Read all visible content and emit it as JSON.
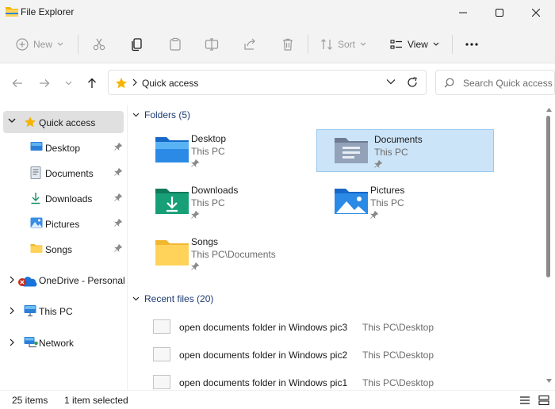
{
  "window": {
    "title": "File Explorer"
  },
  "commands": {
    "new_label": "New",
    "sort_label": "Sort",
    "view_label": "View"
  },
  "address": {
    "crumb": "Quick access"
  },
  "search": {
    "placeholder": "Search Quick access"
  },
  "nav_pane": {
    "quick_access": "Quick access",
    "pinned": [
      {
        "label": "Desktop",
        "icon": "desktop-icon"
      },
      {
        "label": "Documents",
        "icon": "documents-icon"
      },
      {
        "label": "Downloads",
        "icon": "downloads-icon"
      },
      {
        "label": "Pictures",
        "icon": "pictures-icon"
      },
      {
        "label": "Songs",
        "icon": "folder-icon"
      }
    ],
    "onedrive": "OneDrive - Personal",
    "this_pc": "This PC",
    "network": "Network"
  },
  "folders": {
    "header": "Folders (5)",
    "items": [
      {
        "name": "Desktop",
        "location": "This PC",
        "icon": "desktop-folder-icon"
      },
      {
        "name": "Documents",
        "location": "This PC",
        "icon": "documents-folder-icon",
        "selected": true
      },
      {
        "name": "Downloads",
        "location": "This PC",
        "icon": "downloads-folder-icon"
      },
      {
        "name": "Pictures",
        "location": "This PC",
        "icon": "pictures-folder-icon"
      },
      {
        "name": "Songs",
        "location": "This PC\\Documents",
        "icon": "folder-icon"
      }
    ]
  },
  "recent": {
    "header": "Recent files (20)",
    "items": [
      {
        "name": "open documents folder in Windows pic3",
        "location": "This PC\\Desktop"
      },
      {
        "name": "open documents folder in Windows pic2",
        "location": "This PC\\Desktop"
      },
      {
        "name": "open documents folder in Windows pic1",
        "location": "This PC\\Desktop"
      }
    ]
  },
  "status": {
    "items": "25 items",
    "selected": "1 item selected"
  },
  "colors": {
    "accent": "#0067c0",
    "selection": "#cce4f7",
    "folder_yellow": "#ffc83d",
    "group_header": "#1b3a73"
  }
}
